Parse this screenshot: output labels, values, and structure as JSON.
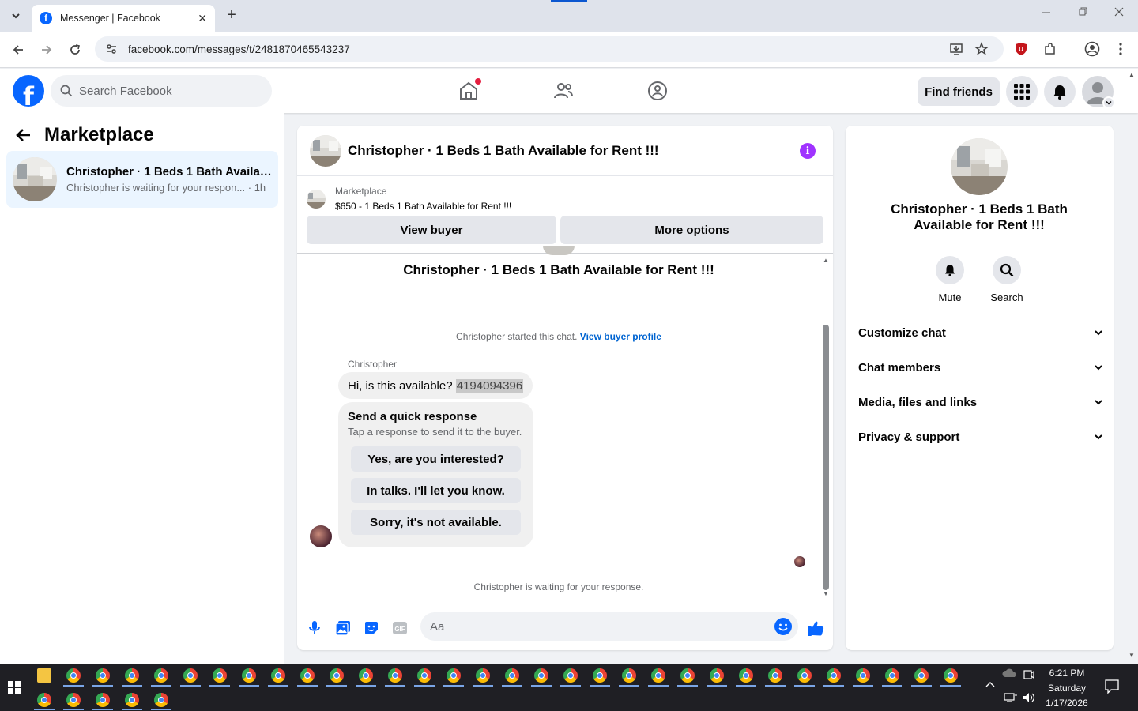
{
  "browser": {
    "tab_title": "Messenger | Facebook",
    "url": "facebook.com/messages/t/2481870465543237",
    "new_tab_label": "+",
    "tab_close": "✕"
  },
  "fb_header": {
    "logo_letter": "f",
    "search_placeholder": "Search Facebook",
    "find_friends": "Find friends"
  },
  "left_panel": {
    "title": "Marketplace",
    "conversation": {
      "name": "Christopher · 1 Beds 1 Bath Availab...",
      "preview": "Christopher is waiting for your respon... · 1h"
    }
  },
  "chat": {
    "header_title": "Christopher · 1 Beds 1 Bath Available for Rent !!!",
    "marketplace_label": "Marketplace",
    "listing": "$650 - 1 Beds 1 Bath Available for Rent !!!",
    "view_buyer": "View buyer",
    "more_options": "More options",
    "center_title": "Christopher · 1 Beds 1 Bath Available for Rent !!!",
    "started_text": "Christopher started this chat.",
    "view_buyer_profile": "View buyer profile",
    "sender_name": "Christopher",
    "message_text": "Hi, is this available?",
    "message_phone": "4194094396",
    "quick_title": "Send a quick response",
    "quick_sub": "Tap a response to send it to the buyer.",
    "quick_responses": [
      "Yes, are you interested?",
      "In talks. I'll let you know.",
      "Sorry, it's not available."
    ],
    "waiting_text": "Christopher is waiting for your response.",
    "input_placeholder": "Aa"
  },
  "right_panel": {
    "name": "Christopher · 1 Beds 1 Bath Available for Rent !!!",
    "mute": "Mute",
    "search": "Search",
    "sections": [
      "Customize chat",
      "Chat members",
      "Media, files and links",
      "Privacy & support"
    ]
  },
  "taskbar": {
    "time": "6:21 PM",
    "day": "Saturday",
    "date": "1/17/2026"
  },
  "colors": {
    "fb_blue": "#0866ff",
    "info_purple": "#a033ff",
    "selected_bg": "#ebf5ff"
  }
}
